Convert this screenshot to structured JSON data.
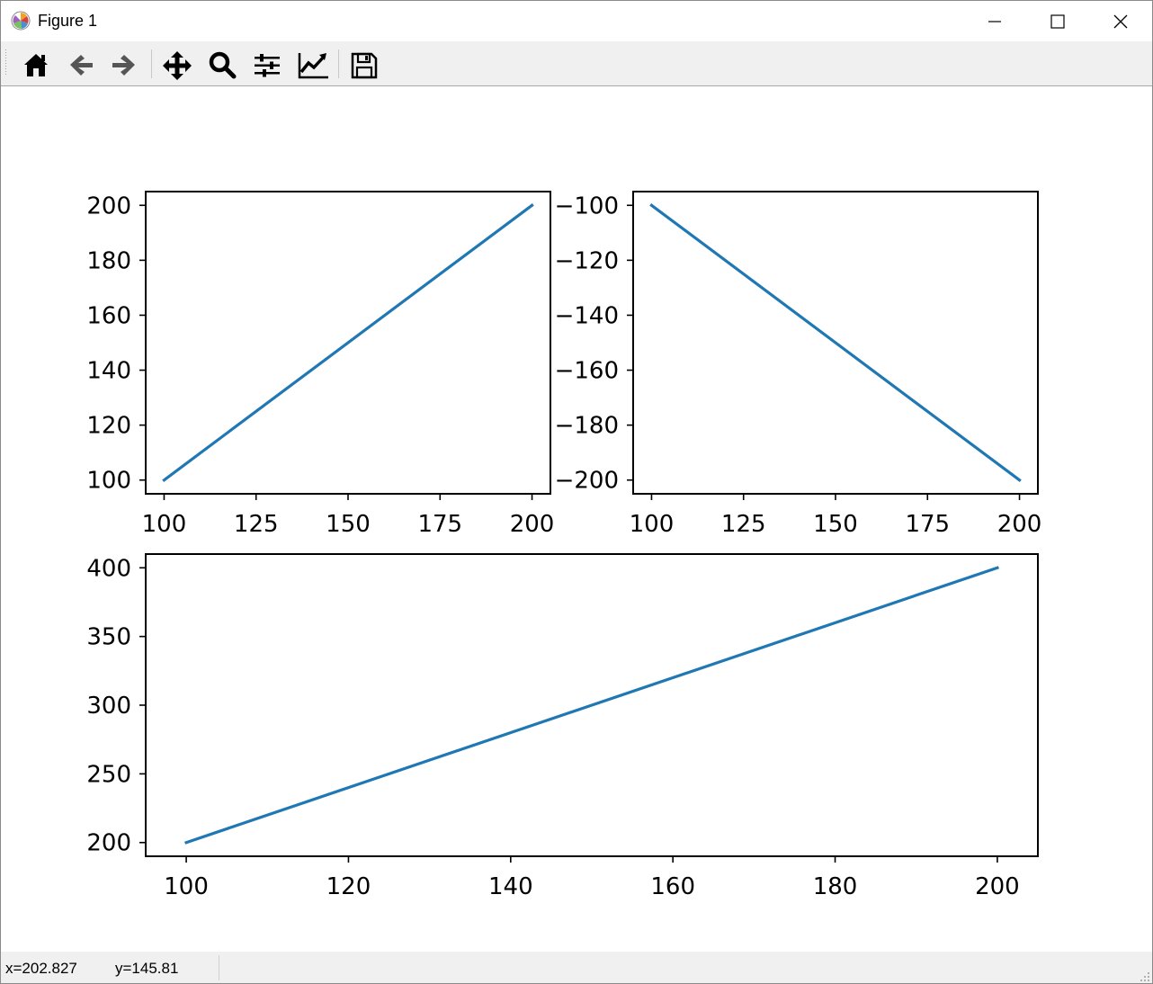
{
  "window": {
    "title": "Figure 1",
    "app_icon": "matplotlib-logo-icon",
    "controls": {
      "minimize_icon": "minimize-icon",
      "maximize_icon": "maximize-icon",
      "close_icon": "close-icon"
    }
  },
  "toolbar": {
    "buttons": [
      {
        "name": "home-button",
        "icon": "home-icon"
      },
      {
        "name": "back-button",
        "icon": "arrow-left-icon"
      },
      {
        "name": "forward-button",
        "icon": "arrow-right-icon"
      },
      {
        "name": "pan-button",
        "icon": "move-arrows-icon"
      },
      {
        "name": "zoom-button",
        "icon": "magnifier-icon"
      },
      {
        "name": "configure-subplots-button",
        "icon": "sliders-icon"
      },
      {
        "name": "edit-axis-button",
        "icon": "line-chart-icon"
      },
      {
        "name": "save-button",
        "icon": "floppy-disk-icon"
      }
    ]
  },
  "status": {
    "x_readout": "x=202.827",
    "y_readout": "y=145.81"
  },
  "colors": {
    "line": "#1f77b4",
    "axes": "#000000",
    "toolbar_bg": "#f0f0f0"
  },
  "chart_data": [
    {
      "type": "line",
      "x": [
        100,
        200
      ],
      "y": [
        100,
        200
      ],
      "xlim": [
        95,
        205
      ],
      "ylim": [
        95,
        205
      ],
      "xticks": [
        100,
        125,
        150,
        175,
        200
      ],
      "yticks": [
        100,
        120,
        140,
        160,
        180,
        200
      ],
      "xlabel": "",
      "ylabel": "",
      "title": "",
      "grid": false
    },
    {
      "type": "line",
      "x": [
        100,
        200
      ],
      "y": [
        -100,
        -200
      ],
      "xlim": [
        95,
        205
      ],
      "ylim": [
        -205,
        -95
      ],
      "xticks": [
        100,
        125,
        150,
        175,
        200
      ],
      "yticks": [
        -100,
        -120,
        -140,
        -160,
        -180,
        -200
      ],
      "ytick_labels": [
        "−100",
        "−120",
        "−140",
        "−160",
        "−180",
        "−200"
      ],
      "xlabel": "",
      "ylabel": "",
      "title": "",
      "grid": false
    },
    {
      "type": "line",
      "x": [
        100,
        200
      ],
      "y": [
        200,
        400
      ],
      "xlim": [
        95,
        205
      ],
      "ylim": [
        190,
        410
      ],
      "xticks": [
        100,
        120,
        140,
        160,
        180,
        200
      ],
      "yticks": [
        200,
        250,
        300,
        350,
        400
      ],
      "xlabel": "",
      "ylabel": "",
      "title": "",
      "grid": false
    }
  ]
}
